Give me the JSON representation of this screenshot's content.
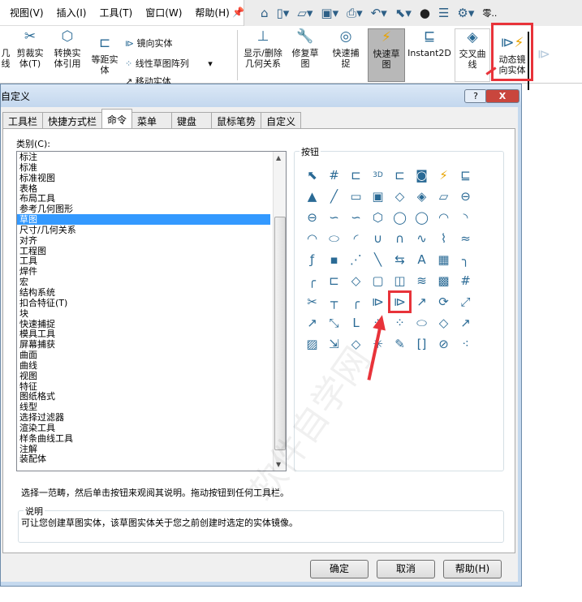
{
  "menu": [
    "视图(V)",
    "插入(I)",
    "工具(T)",
    "窗口(W)",
    "帮助(H)"
  ],
  "qat_icons": [
    "home-icon",
    "new-icon",
    "open-icon",
    "save-icon",
    "print-icon",
    "undo-icon",
    "select-icon",
    "rebuild-icon",
    "options-list-icon",
    "gear-icon"
  ],
  "qat_search": "零..",
  "ribbon": {
    "partial_left": "几\n线",
    "trim": "剪裁实\n体(T)",
    "convert": "转换实\n体引用",
    "offset": "等距实\n体",
    "mirror": "镜向实体",
    "linear_pattern": "线性草图阵列",
    "move": "移动实体",
    "relations": "显示/删除\n几何关系",
    "repair": "修复草\n图",
    "quick_snaps": "快速捕\n捉",
    "rapid_sketch": "快速草\n图",
    "instant2d": "Instant2D",
    "intersection": "交叉曲\n线",
    "dynamic_mirror": "动态镜\n向实体"
  },
  "dialog": {
    "title": "自定义",
    "help_btn": "?",
    "close_btn": "X",
    "tabs": [
      "工具栏",
      "快捷方式栏",
      "命令",
      "菜单",
      "键盘",
      "鼠标笔势",
      "自定义"
    ],
    "selected_tab": 2,
    "category_label": "类别(C):",
    "categories": [
      "标注",
      "标准",
      "标准视图",
      "表格",
      "布局工具",
      "参考几何图形",
      "草图",
      "尺寸/几何关系",
      "对齐",
      "工程图",
      "工具",
      "焊件",
      "宏",
      "结构系统",
      "扣合特征(T)",
      "块",
      "快速捕捉",
      "模具工具",
      "屏幕捕获",
      "曲面",
      "曲线",
      "视图",
      "特征",
      "图纸格式",
      "线型",
      "选择过滤器",
      "渲染工具",
      "样条曲线工具",
      "注解",
      "装配体"
    ],
    "selected_category": 6,
    "buttons_label": "按钮",
    "instruction": "选择一范畴，然后单击按钮来观阅其说明。拖动按钮到任何工具栏。",
    "description_label": "说明",
    "description": "可让您创建草图实体，该草图实体关于您之前创建时选定的实体镜像。",
    "ok": "确定",
    "cancel": "取消",
    "help": "帮助(H)"
  },
  "button_icons": [
    "select-icon",
    "grid-icon",
    "sketch-icon",
    "3d-sketch-icon",
    "3d-sketch-on-plane-icon",
    "section-icon",
    "rapid-sketch-icon",
    "instant2d-icon",
    "shapes-icon",
    "line-icon",
    "corner-rectangle-icon",
    "center-rectangle-icon",
    "3pt-corner-rectangle-icon",
    "3pt-center-rectangle-icon",
    "parallelogram-icon",
    "straight-slot-icon",
    "centerpoint-slot-icon",
    "3pt-arc-slot-icon",
    "centerpoint-arc-slot-icon",
    "polygon-icon",
    "circle-icon",
    "perimeter-circle-icon",
    "centerpoint-arc-icon",
    "tangent-arc-icon",
    "3pt-arc-icon",
    "ellipse-icon",
    "partial-ellipse-icon",
    "parabola-icon",
    "conic-icon",
    "spline-icon",
    "spline-points-icon",
    "face-curve-icon",
    "equation-curve-icon",
    "point-icon",
    "centerline-icon",
    "midpoint-line-icon",
    "mirror-line-icon",
    "text-icon",
    "plane-icon",
    "fillet-icon",
    "chamfer-icon",
    "offset-icon",
    "surface-offset-icon",
    "convert-icon",
    "silhouette-icon",
    "intersection-curve-icon",
    "mesh-icon",
    "segment-icon",
    "trim-icon",
    "extend-icon",
    "split-icon",
    "mirror-entities-icon",
    "dynamic-mirror-icon",
    "move-icon",
    "rotate-icon",
    "scale-icon",
    "copy-icon",
    "stretch-icon",
    "jog-line-icon",
    "linear-pattern-icon",
    "circular-pattern-icon",
    "closed-spline-icon",
    "modify-icon",
    "copy-entities-icon",
    "sketch-picture-icon",
    "dimension-icon",
    "sketch-block-icon",
    "explode-icon",
    "sketch-pen-icon",
    "fit-spline-icon",
    "belt-chain-icon",
    "route-line-icon"
  ],
  "highlighted_button": 52,
  "colors": {
    "accent": "#3399ff",
    "highlight": "#e8333a",
    "icon": "#2a6a95"
  },
  "watermark": "软件自学网 WWW.RJZXW.COM"
}
